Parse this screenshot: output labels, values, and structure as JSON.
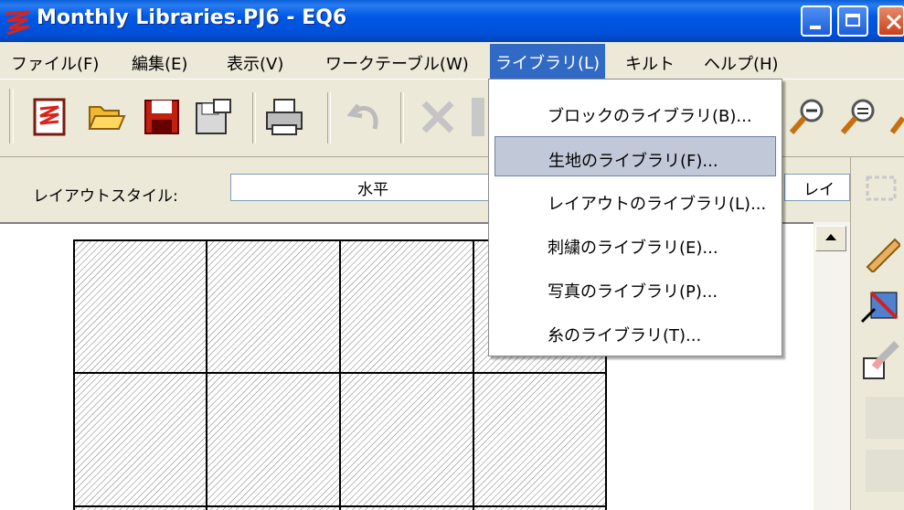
{
  "window": {
    "title": "Monthly Libraries.PJ6 - EQ6"
  },
  "menubar": {
    "items": [
      {
        "label": "ファイル(F)"
      },
      {
        "label": "編集(E)"
      },
      {
        "label": "表示(V)"
      },
      {
        "label": "ワークテーブル(W)"
      },
      {
        "label": "ライブラリ(L)"
      },
      {
        "label": "キルト"
      },
      {
        "label": "ヘルプ(H)"
      }
    ],
    "active_index": 4
  },
  "toolbar": {
    "icons": [
      "new-project-icon",
      "open-folder-icon",
      "save-icon",
      "save-as-icon",
      "print-icon",
      "undo-icon",
      "cut-icon",
      "zoom-out-icon",
      "zoom-in-icon"
    ]
  },
  "layout_style": {
    "label": "レイアウトスタイル:",
    "value": "水平",
    "right_value": "レイ"
  },
  "library_menu": {
    "items": [
      {
        "label": "ブロックのライブラリ(B)..."
      },
      {
        "label": "生地のライブラリ(F)..."
      },
      {
        "label": "レイアウトのライブラリ(L)..."
      },
      {
        "label": "刺繍のライブラリ(E)..."
      },
      {
        "label": "写真のライブラリ(P)..."
      },
      {
        "label": "糸のライブラリ(T)..."
      }
    ],
    "highlighted_index": 1
  },
  "colors": {
    "titlebar": "#0058e6",
    "menu_active": "#316ac5",
    "highlight": "#c1c9d9"
  }
}
